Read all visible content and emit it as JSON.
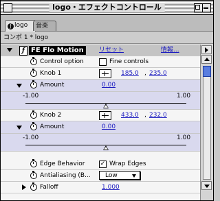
{
  "window": {
    "title": "logo・エフェクトコントロール"
  },
  "tabs": [
    {
      "label": "logo",
      "active": true
    },
    {
      "label": "音楽",
      "active": false
    }
  ],
  "comp_header": "コンポ 1 * logo",
  "effect": {
    "name": "FE Flo Motion",
    "reset_label": "リセット",
    "about_label": "情報..."
  },
  "params": {
    "control_option": {
      "label": "Control option",
      "checkbox_label": "Fine controls",
      "checked": false
    },
    "knob1": {
      "label": "Knob 1",
      "x": "185.0",
      "y": "235.0"
    },
    "amount1": {
      "label": "Amount",
      "value": "0.00",
      "min": "-1.00",
      "max": "1.00",
      "level": 0.0
    },
    "knob2": {
      "label": "Knob 2",
      "x": "433.0",
      "y": "232.0"
    },
    "amount2": {
      "label": "Amount",
      "value": "0.00",
      "min": "-1.00",
      "max": "1.00",
      "level": 0.0
    },
    "edge_behavior": {
      "label": "Edge Behavior",
      "checkbox_label": "Wrap Edges",
      "checked": true
    },
    "antialiasing": {
      "label": "Antialiasing (B...",
      "selected": "Low"
    },
    "falloff": {
      "label": "Falloff",
      "value": "1.000"
    }
  },
  "separator": ","
}
